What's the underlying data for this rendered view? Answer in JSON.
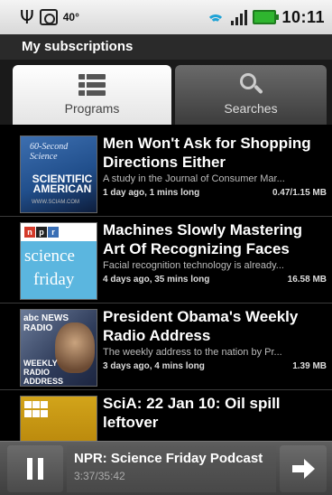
{
  "status_bar": {
    "usb_icon": "usb-icon",
    "notification_icon": "notification-box-icon",
    "temperature": "40°",
    "wifi_icon": "wifi-icon",
    "signal_icon": "signal-bars-icon",
    "battery_icon": "battery-charging-icon",
    "time": "10:11"
  },
  "title_bar": {
    "title": "My subscriptions"
  },
  "tabs": [
    {
      "label": "Programs",
      "icon": "list-icon",
      "selected": true
    },
    {
      "label": "Searches",
      "icon": "search-icon",
      "selected": false
    }
  ],
  "items": [
    {
      "title": "Men Won't Ask for Shopping Directions Either",
      "description": "A study in the Journal of Consumer Mar...",
      "age": "1 day ago, 1 mins long",
      "size": "0.47/1.15 MB",
      "thumbnail": {
        "line1": "60-Second Science",
        "line2": "SCIENTIFIC AMERICAN",
        "line3": "WWW.SCIAM.COM"
      }
    },
    {
      "title": "Machines Slowly Mastering Art Of Recognizing Faces",
      "description": "Facial recognition technology is already...",
      "age": "4 days ago, 35 mins long",
      "size": "16.58 MB",
      "thumbnail": {
        "line1": "n",
        "line2": "p",
        "line3": "r",
        "line4": "science",
        "line5": "friday"
      }
    },
    {
      "title": "President Obama's Weekly Radio Address",
      "description": "The weekly address to the nation by Pr...",
      "age": "3 days ago, 4 mins long",
      "size": "1.39 MB",
      "thumbnail": {
        "line1": "abc NEWS RADIO",
        "line2": "WEEKLY RADIO ADDRESS"
      }
    },
    {
      "title": "SciA: 22 Jan 10: Oil spill leftover",
      "description": "",
      "age": "",
      "size": "",
      "thumbnail": {}
    }
  ],
  "player": {
    "pause_icon": "pause-icon",
    "next_icon": "next-arrow-icon",
    "now_playing_title": "NPR: Science Friday Podcast",
    "elapsed_total": "3:37/35:42"
  }
}
